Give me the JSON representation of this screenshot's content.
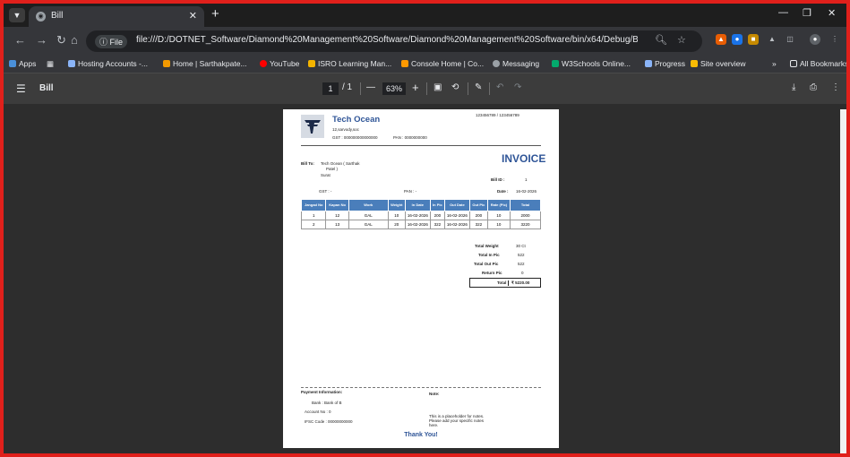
{
  "browser": {
    "tab_title": "Bill",
    "url": "file:///D:/DOTNET_Software/Diamond%20Management%20Software/Diamond%20Management%20Software/bin/x64/Debug/Bills/Sarthak%20Patel/Man...",
    "file_chip": "File",
    "bookmarks": [
      "Apps",
      "Hosting Accounts -...",
      "Home | Sarthakpate...",
      "YouTube",
      "ISRO Learning Man...",
      "Console Home | Co...",
      "Messaging",
      "W3Schools Online...",
      "Progress",
      "Site overview"
    ],
    "bookmarks_more": "»",
    "all_bookmarks": "All Bookmarks"
  },
  "pdf": {
    "title": "Bill",
    "page_current": "1",
    "page_total": "/ 1",
    "zoom": "63%",
    "minus": "—",
    "plus": "+"
  },
  "invoice": {
    "company": "Tech Ocean",
    "company_sub": "12,sarvody,soc",
    "gst": "GST : 000000000000000",
    "pan": "PAN : 0000000000",
    "phones": "123456789 / 123456789",
    "heading": "INVOICE",
    "bill_to_label": "Bill To:",
    "bill_to_name_1": "Tech Ocean  ( Sarthak",
    "bill_to_name_2": "Patel )",
    "bill_to_city": "Surat",
    "customer_gst": "GST : -",
    "customer_pan": "PAN : -",
    "bill_id_label": "Bill ID :",
    "bill_id": "1",
    "date_label": "Date :",
    "date": "16-02-2026",
    "columns": [
      "Jangad No",
      "Kapan No",
      "Work",
      "Weight",
      "In Date",
      "In Pic",
      "Out Date",
      "Out Pic",
      "Rate (Pic)",
      "Total"
    ],
    "rows": [
      [
        "1",
        "12",
        "GAL",
        "10",
        "16-02-2026",
        "200",
        "16-02-2026",
        "200",
        "10",
        "2000"
      ],
      [
        "2",
        "13",
        "GAL",
        "20",
        "16-02-2026",
        "322",
        "16-02-2026",
        "322",
        "10",
        "3220"
      ]
    ],
    "totals": [
      {
        "label": "Total Weight",
        "value": "30 Ct"
      },
      {
        "label": "Total In Pic",
        "value": "522"
      },
      {
        "label": "Total Out Pic",
        "value": "522"
      },
      {
        "label": "Return Pic",
        "value": "0"
      }
    ],
    "grand_total_label": "Total",
    "grand_total": "₹ 5220.00",
    "payment_heading": "Payment Information:",
    "bank": "Bank : Bank of B",
    "account": "Account No : 0",
    "ifsc": "IFSC Code : 00000000000",
    "note_heading": "Note:",
    "note_1": "This is a placeholder for notes.",
    "note_2": "Please add your specific notes",
    "note_3": "here.",
    "thanks": "Thank You!"
  }
}
